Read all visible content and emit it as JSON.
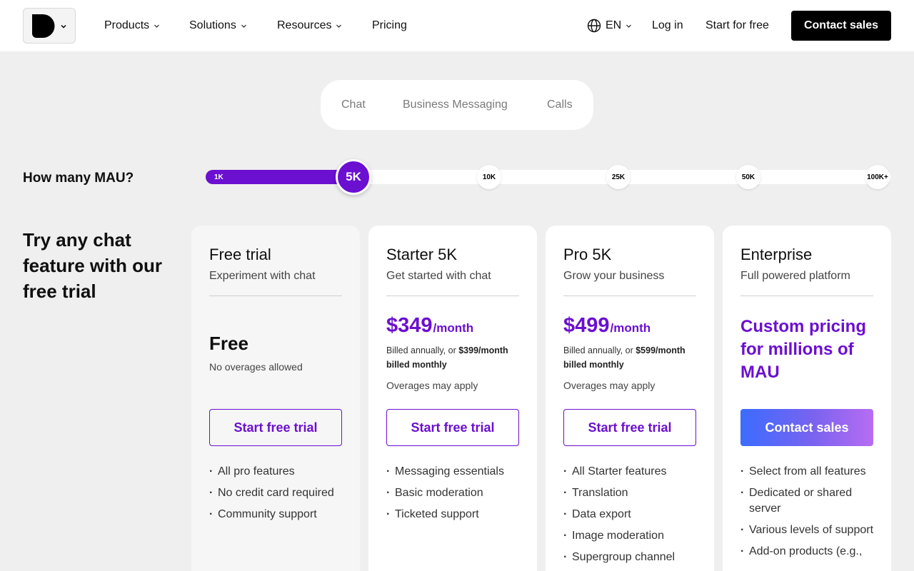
{
  "nav": {
    "products": "Products",
    "solutions": "Solutions",
    "resources": "Resources",
    "pricing": "Pricing",
    "language": "EN",
    "login": "Log in",
    "start_free": "Start for free",
    "contact_sales": "Contact sales"
  },
  "tabs": [
    "Chat",
    "Business Messaging",
    "Calls"
  ],
  "mau": {
    "label": "How many MAU?",
    "ticks": [
      "1K",
      "5K",
      "10K",
      "25K",
      "50K",
      "100K+"
    ],
    "selected": "5K",
    "selected_index": 1
  },
  "headline": "Try any chat feature with our free trial",
  "cards": [
    {
      "title": "Free trial",
      "subtitle": "Experiment with chat",
      "price_label": "Free",
      "note": "No overages allowed",
      "button": "Start free trial",
      "features": [
        "All pro features",
        "No credit card required",
        "Community support"
      ]
    },
    {
      "title": "Starter 5K",
      "subtitle": "Get started with chat",
      "price": "$349",
      "per": "/month",
      "billing_prefix": "Billed annually, or ",
      "billing_bold": "$399/month billed monthly",
      "overages": "Overages may apply",
      "button": "Start free trial",
      "features": [
        "Messaging essentials",
        "Basic moderation",
        "Ticketed support"
      ]
    },
    {
      "title": "Pro 5K",
      "subtitle": "Grow your business",
      "price": "$499",
      "per": "/month",
      "billing_prefix": "Billed annually, or ",
      "billing_bold": "$599/month billed monthly",
      "overages": "Overages may apply",
      "button": "Start free trial",
      "features": [
        "All Starter features",
        "Translation",
        "Data export",
        "Image moderation",
        "Supergroup channel"
      ]
    },
    {
      "title": "Enterprise",
      "subtitle": "Full powered platform",
      "custom_price": "Custom pricing for millions of MAU",
      "button": "Contact sales",
      "features": [
        "Select from all features",
        "Dedicated or shared server",
        "Various levels of support",
        "Add-on products (e.g.,"
      ]
    }
  ],
  "colors": {
    "accent": "#6b0fd1",
    "background": "#efefef",
    "nav_bg": "#ffffff",
    "cta_dark": "#000000"
  }
}
